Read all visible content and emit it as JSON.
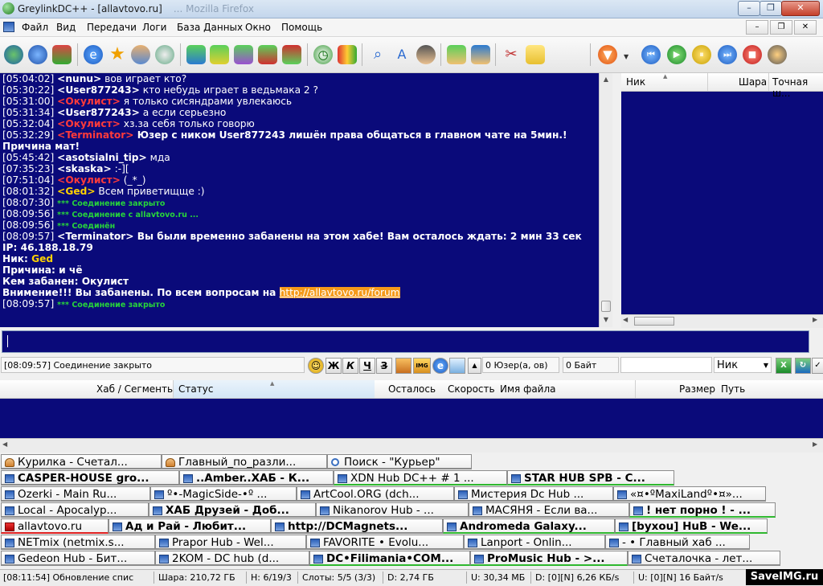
{
  "window": {
    "title": "GreylinkDC++ - [allavtovo.ru]",
    "title_ghost": "...   Mozilla Firefox",
    "minimize": "–",
    "maximize": "❐",
    "close": "✕"
  },
  "menu": {
    "items": [
      "Файл",
      "Вид",
      "Передачи",
      "Логи",
      "База Данных",
      "Окно",
      "Помощь"
    ],
    "mdi_min": "–",
    "mdi_restore": "❐",
    "mdi_close": "✕"
  },
  "chat": {
    "lines": [
      {
        "ts": "[05:04:02]",
        "nick": "<nunu>",
        "nick_color": "white",
        "text": " вов играет кто?",
        "bold": false
      },
      {
        "ts": "[05:30:22]",
        "nick": "<User877243>",
        "nick_color": "white",
        "text": " кто небудь   играет  в ведьмака 2    ?",
        "bold": false
      },
      {
        "ts": "[05:31:00]",
        "nick": "<Окулист>",
        "nick_color": "red",
        "text": " я только сисяндрами увлекаюсь",
        "bold": false
      },
      {
        "ts": "[05:31:34]",
        "nick": "<User877243>",
        "nick_color": "white",
        "text": " а   если серьезно",
        "bold": false
      },
      {
        "ts": "[05:32:04]",
        "nick": "<Окулист>",
        "nick_color": "red",
        "text": " хз.за себя только говорю",
        "bold": false
      },
      {
        "ts": "[05:32:29]",
        "nick": "<Terminator>",
        "nick_color": "red",
        "text": " Юзер с ником User877243 лишён права общаться в главном чате на 5мин.!",
        "bold": true
      },
      {
        "ts": "",
        "nick": "",
        "nick_color": "white",
        "text": "Причина мат!",
        "bold": true
      },
      {
        "ts": "[05:45:42]",
        "nick": "<asotsialni_tip>",
        "nick_color": "white",
        "text": " мда",
        "bold": false
      },
      {
        "ts": "[07:35:23]",
        "nick": "<skaska>",
        "nick_color": "white",
        "text": "  :-][",
        "bold": false
      },
      {
        "ts": "[07:51:04]",
        "nick": "<Окулист>",
        "nick_color": "red",
        "text": " (_*_)",
        "bold": false
      },
      {
        "ts": "[08:01:32]",
        "nick": "<Ged>",
        "nick_color": "gold",
        "text": " Всем приветищще :)",
        "bold": false
      },
      {
        "ts": "[08:07:30]",
        "nick": "",
        "nick_color": "white",
        "text": " *** Соединение закрыто",
        "green": true
      },
      {
        "ts": "[08:09:56]",
        "nick": "",
        "nick_color": "white",
        "text": " *** Соединение с allavtovo.ru ...",
        "green": true
      },
      {
        "ts": "[08:09:56]",
        "nick": "",
        "nick_color": "white",
        "text": " *** Соединён",
        "green": true
      },
      {
        "ts": "[08:09:57]",
        "nick": "<Terminator>",
        "nick_color": "white",
        "text": " Вы были временно забанены на этом хабе! Вам осталось ждать: 2 мин 33 сек",
        "bold": true
      },
      {
        "ts": "",
        "nick": "",
        "nick_color": "white",
        "text": "IP: 46.188.18.79",
        "bold": true
      },
      {
        "ts": "",
        "nick": "",
        "nick_color": "white",
        "text": "Ник: ",
        "bold": true,
        "extra": "Ged",
        "extra_color": "gold"
      },
      {
        "ts": "",
        "nick": "",
        "nick_color": "white",
        "text": "Причина: и чё",
        "bold": true
      },
      {
        "ts": "",
        "nick": "",
        "nick_color": "white",
        "text": "Кем забанен: Окулист",
        "bold": true
      },
      {
        "ts": "",
        "nick": "",
        "nick_color": "white",
        "text": "Внимение!!! Вы забанены. По всем вопросам на ",
        "bold": true,
        "link": "http://allavtovo.ru/forum"
      },
      {
        "ts": "[08:09:57]",
        "nick": "",
        "nick_color": "white",
        "text": " *** Соединение закрыто",
        "green": true
      }
    ]
  },
  "userlist": {
    "columns": [
      "Ник",
      "Шара",
      "Точная ш..."
    ]
  },
  "status_row": {
    "last_message": "[08:09:57] Соединение закрыто",
    "format_buttons": [
      "Ж",
      "К",
      "Ч",
      "З"
    ],
    "img_tag": "IMG",
    "users": "0 Юзер(а, ов)",
    "bytes": "0 Байт",
    "filter_select": "Ник"
  },
  "transfers": {
    "columns": [
      "Хаб / Сегменты",
      "Статус",
      "Осталось",
      "Скорость",
      "Имя файла",
      "Размер",
      "Путь"
    ]
  },
  "tabs": {
    "rows": [
      [
        {
          "label": "Курилка - Счетал...",
          "type": "u",
          "w": 200
        },
        {
          "label": "Главный_по_разли...",
          "type": "u",
          "w": 206
        },
        {
          "label": "Поиск - \"Курьер\"",
          "type": "s",
          "w": 180
        }
      ],
      [
        {
          "label": "CASPER-HOUSE gro...",
          "type": "h",
          "w": 222,
          "b": true
        },
        {
          "label": "..Amber..ХАБ - К...",
          "type": "h",
          "w": 192,
          "b": true
        },
        {
          "label": "XDN Hub DC++ # 1 ...",
          "type": "h",
          "w": 216,
          "g": true
        },
        {
          "label": "STAR HUB SPB - C...",
          "type": "h",
          "w": 208,
          "b": true,
          "g": true
        }
      ],
      [
        {
          "label": "Ozerki - Main Ru...",
          "type": "h",
          "w": 186
        },
        {
          "label": "º•-MagicSide-•º ...",
          "type": "h",
          "w": 182
        },
        {
          "label": "ArtCool.ORG (dch...",
          "type": "h",
          "w": 196
        },
        {
          "label": "Мистерия Dc Hub ...",
          "type": "h",
          "w": 198
        },
        {
          "label": "«¤•ºMaxiLandº•¤»...",
          "type": "h",
          "w": 190
        }
      ],
      [
        {
          "label": "Local - Apocalyp...",
          "type": "h",
          "w": 184
        },
        {
          "label": "ХАБ Друзей - Доб...",
          "type": "h",
          "w": 208,
          "b": true
        },
        {
          "label": "Nikanorov Hub - ...",
          "type": "h",
          "w": 190
        },
        {
          "label": "МАСЯНЯ - Если ва...",
          "type": "h",
          "w": 200
        },
        {
          "label": "! нет порно ! - ...",
          "type": "h",
          "w": 182,
          "b": true,
          "g": true
        }
      ],
      [
        {
          "label": "allavtovo.ru",
          "type": "r",
          "w": 134,
          "r": true
        },
        {
          "label": "Ад и Рай - Любит...",
          "type": "h",
          "w": 202,
          "b": true
        },
        {
          "label": "http://DCMagnets...",
          "type": "h",
          "w": 214,
          "b": true
        },
        {
          "label": "Andromeda Galaxy...",
          "type": "h",
          "w": 214,
          "b": true,
          "g": true
        },
        {
          "label": "[byxou] HuB - We...",
          "type": "h",
          "w": 190,
          "b": true,
          "g": true
        }
      ],
      [
        {
          "label": "NETmix (netmix.s...",
          "type": "h",
          "w": 192
        },
        {
          "label": "Prapor Hub - Wel...",
          "type": "h",
          "w": 188
        },
        {
          "label": "FAVORITE • Evolu...",
          "type": "h",
          "w": 196
        },
        {
          "label": "Lanport - Onlin...",
          "type": "h",
          "w": 176
        },
        {
          "label": "- • Главный хаб ...",
          "type": "h",
          "w": 180
        }
      ],
      [
        {
          "label": "Gedeon Hub - Бит...",
          "type": "h",
          "w": 192
        },
        {
          "label": "2KOM - DC hub (d...",
          "type": "h",
          "w": 192
        },
        {
          "label": "DC•Filimania•COM...",
          "type": "h",
          "w": 200,
          "b": true,
          "g": true
        },
        {
          "label": "ProMusic Hub - >...",
          "type": "h",
          "w": 196,
          "b": true,
          "g": true
        },
        {
          "label": "Счеталочка - лет...",
          "type": "h",
          "w": 190
        }
      ]
    ]
  },
  "bottombar": {
    "cells": [
      "[08:11:54] Обновление спис",
      "Шара: 210,72 ГБ",
      "H: 6/19/3",
      "Слоты: 5/5 (3/3)",
      "D: 2,74 ГБ",
      "U: 30,34 МБ",
      "D: [0][N] 6,26 КБ/s",
      "U: [0][N] 16 Байт/s"
    ],
    "watermark": "SaveIMG.ru"
  },
  "colors": {
    "pane_bg": "#0a0a7a",
    "nick_red": "#ff3b3b",
    "nick_gold": "#ffd200",
    "system_green": "#27d33b",
    "link_bg": "#f59a1a"
  },
  "toolbar": {
    "icons": [
      "connect-icon",
      "reconnect-icon",
      "favorites-hubs-icon",
      "ie-icon",
      "star-icon",
      "users-icon",
      "recent-hubs-icon",
      "download-queue-icon",
      "finished-downloads-icon",
      "upload-queue-icon",
      "finished-uploads-icon",
      "network-stats-icon",
      "clock-icon",
      "stats-chart-icon",
      "search-icon",
      "adl-search-icon",
      "spy-icon",
      "open-file-list-icon",
      "refresh-list-icon",
      "settings-icon",
      "notepad-icon",
      "firefox-icon",
      "player-prev-icon",
      "player-play-icon",
      "player-pause-icon",
      "player-next-icon",
      "player-stop-icon",
      "winamp-icon"
    ]
  }
}
